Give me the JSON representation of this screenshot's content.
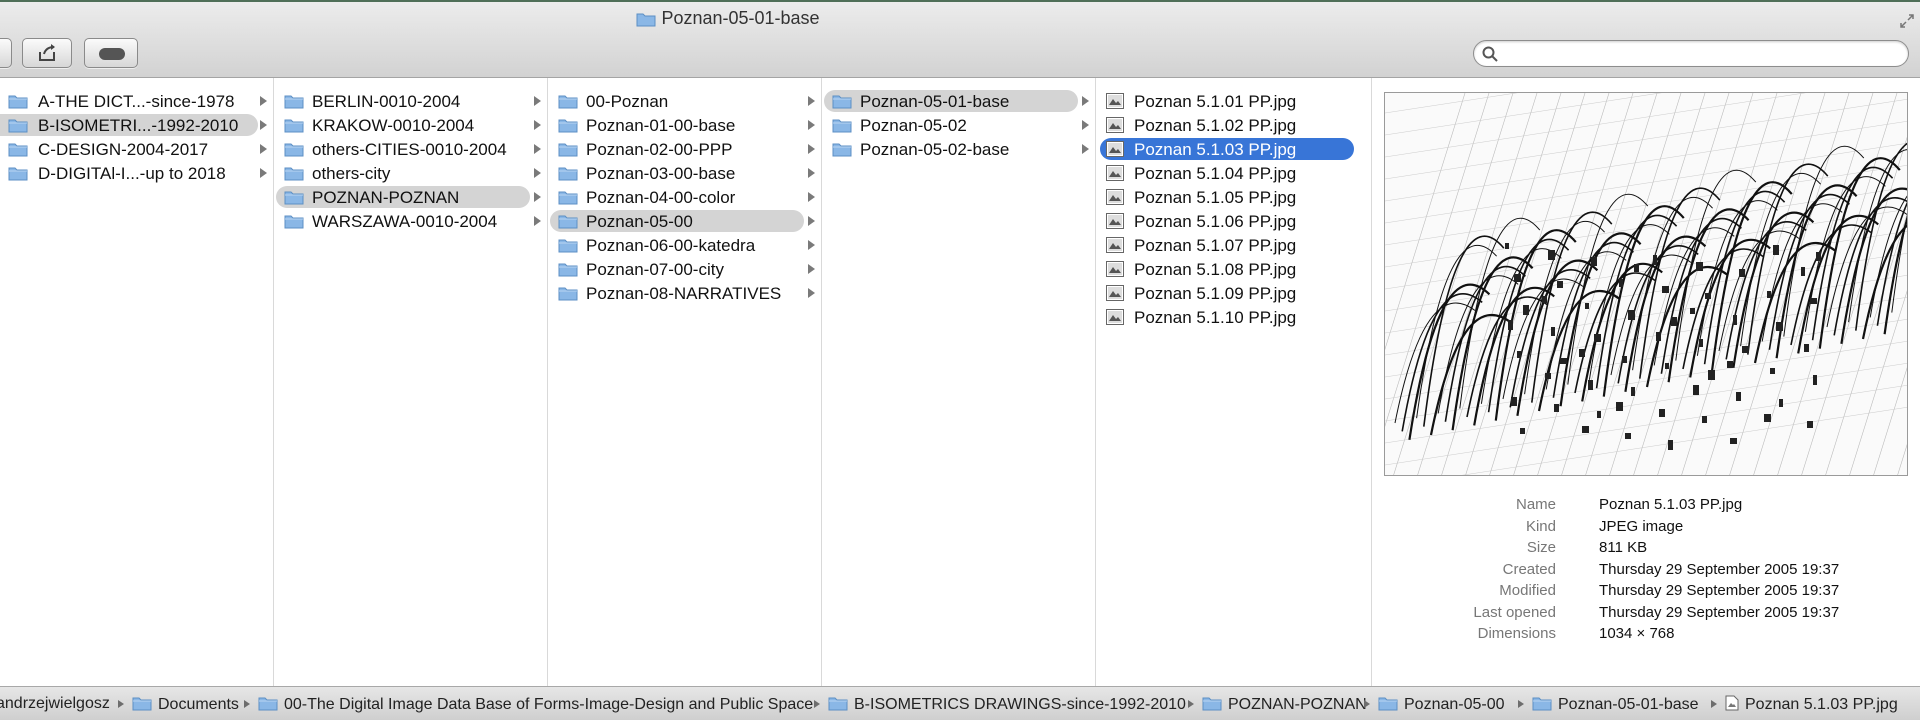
{
  "window": {
    "title": "Poznan-05-01-base",
    "search": {
      "placeholder": "",
      "value": ""
    }
  },
  "columns": [
    {
      "items": [
        {
          "label": "A-THE DICT...-since-1978",
          "type": "folder"
        },
        {
          "label": "B-ISOMETRI...-1992-2010",
          "type": "folder",
          "selected": true
        },
        {
          "label": "C-DESIGN-2004-2017",
          "type": "folder"
        },
        {
          "label": "D-DIGITAl-I...-up to 2018",
          "type": "folder"
        }
      ]
    },
    {
      "items": [
        {
          "label": "BERLIN-0010-2004",
          "type": "folder"
        },
        {
          "label": "KRAKOW-0010-2004",
          "type": "folder"
        },
        {
          "label": "others-CITIES-0010-2004",
          "type": "folder"
        },
        {
          "label": "others-city",
          "type": "folder"
        },
        {
          "label": "POZNAN-POZNAN",
          "type": "folder",
          "selected": true
        },
        {
          "label": "WARSZAWA-0010-2004",
          "type": "folder"
        }
      ]
    },
    {
      "items": [
        {
          "label": "00-Poznan",
          "type": "folder"
        },
        {
          "label": "Poznan-01-00-base",
          "type": "folder"
        },
        {
          "label": "Poznan-02-00-PPP",
          "type": "folder"
        },
        {
          "label": "Poznan-03-00-base",
          "type": "folder"
        },
        {
          "label": "Poznan-04-00-color",
          "type": "folder"
        },
        {
          "label": "Poznan-05-00",
          "type": "folder",
          "selected": true
        },
        {
          "label": "Poznan-06-00-katedra",
          "type": "folder"
        },
        {
          "label": "Poznan-07-00-city",
          "type": "folder"
        },
        {
          "label": "Poznan-08-NARRATIVES",
          "type": "folder"
        }
      ]
    },
    {
      "items": [
        {
          "label": "Poznan-05-01-base",
          "type": "folder",
          "selected": true
        },
        {
          "label": "Poznan-05-02",
          "type": "folder"
        },
        {
          "label": "Poznan-05-02-base",
          "type": "folder"
        }
      ]
    },
    {
      "items": [
        {
          "label": "Poznan 5.1.01 PP.jpg",
          "type": "image"
        },
        {
          "label": "Poznan 5.1.02 PP.jpg",
          "type": "image"
        },
        {
          "label": "Poznan 5.1.03 PP.jpg",
          "type": "image",
          "active": true
        },
        {
          "label": "Poznan 5.1.04 PP.jpg",
          "type": "image"
        },
        {
          "label": "Poznan 5.1.05 PP.jpg",
          "type": "image"
        },
        {
          "label": "Poznan 5.1.06 PP.jpg",
          "type": "image"
        },
        {
          "label": "Poznan 5.1.07 PP.jpg",
          "type": "image"
        },
        {
          "label": "Poznan 5.1.08 PP.jpg",
          "type": "image"
        },
        {
          "label": "Poznan 5.1.09 PP.jpg",
          "type": "image"
        },
        {
          "label": "Poznan 5.1.10 PP.jpg",
          "type": "image"
        }
      ]
    }
  ],
  "preview": {
    "info": [
      {
        "key": "Name",
        "value": "Poznan 5.1.03 PP.jpg"
      },
      {
        "key": "Kind",
        "value": "JPEG image"
      },
      {
        "key": "Size",
        "value": "811 KB"
      },
      {
        "key": "Created",
        "value": "Thursday 29 September 2005 19:37"
      },
      {
        "key": "Modified",
        "value": "Thursday 29 September 2005 19:37"
      },
      {
        "key": "Last opened",
        "value": "Thursday 29 September 2005 19:37"
      },
      {
        "key": "Dimensions",
        "value": "1034 × 768"
      }
    ]
  },
  "path_bar": [
    {
      "label": "andrzejwielgosz",
      "icon": "home-icon"
    },
    {
      "label": "Documents",
      "icon": "documents-folder-icon"
    },
    {
      "label": "00-The Digital Image Data Base of Forms-Image-Design and Public Space",
      "icon": "folder-icon"
    },
    {
      "label": "B-ISOMETRICS DRAWINGS-since-1992-2010",
      "icon": "folder-icon"
    },
    {
      "label": "POZNAN-POZNAN",
      "icon": "folder-icon"
    },
    {
      "label": "Poznan-05-00",
      "icon": "folder-icon"
    },
    {
      "label": "Poznan-05-01-base",
      "icon": "folder-icon"
    },
    {
      "label": "Poznan 5.1.03 PP.jpg",
      "icon": "image-file-icon"
    }
  ],
  "colors": {
    "selection": "#3875d7",
    "inactive_selection": "#d4d4d4",
    "folder": "#8ab7e6"
  }
}
